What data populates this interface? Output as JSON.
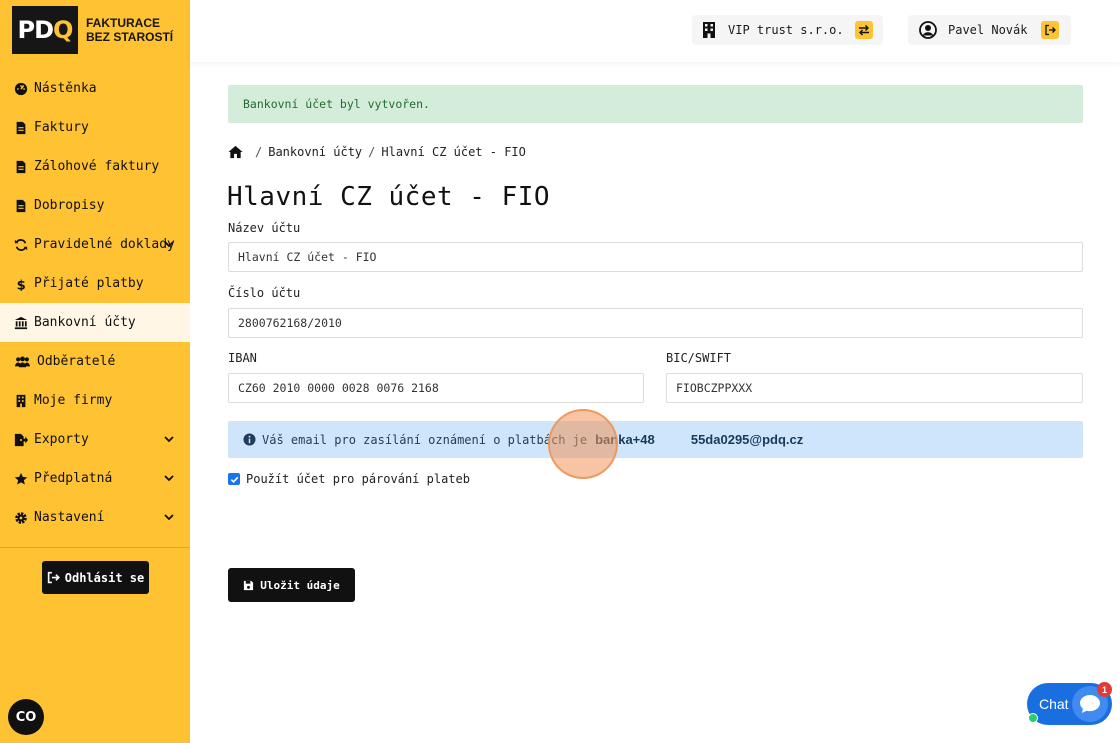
{
  "brand": {
    "logo_text": "PDQ",
    "tagline": "FAKTURACE BEZ STAROSTÍ"
  },
  "sidebar": {
    "items": [
      {
        "label": "Nástěnka",
        "icon": "dashboard-icon"
      },
      {
        "label": "Faktury",
        "icon": "file-icon"
      },
      {
        "label": "Zálohové faktury",
        "icon": "file-icon"
      },
      {
        "label": "Dobropisy",
        "icon": "file-icon"
      },
      {
        "label": "Pravidelné doklady",
        "icon": "sync-icon"
      },
      {
        "label": "Přijaté platby",
        "icon": "dollar-icon"
      },
      {
        "label": "Bankovní účty",
        "icon": "bank-icon",
        "active": true
      },
      {
        "label": "Odběratelé",
        "icon": "users-icon"
      },
      {
        "label": "Moje firmy",
        "icon": "building-icon"
      },
      {
        "label": "Exporty",
        "icon": "export-icon"
      },
      {
        "label": "Předplatná",
        "icon": "star-icon"
      },
      {
        "label": "Nastavení",
        "icon": "gear-icon"
      }
    ],
    "logout_label": "Odhlásit se",
    "co_badge": "CO"
  },
  "topbar": {
    "company": "VIP trust s.r.o.",
    "user": "Pavel Novák"
  },
  "alert_success": "Bankovní účet byl vytvořen.",
  "breadcrumb": {
    "level1": "Bankovní účty",
    "level2": "Hlavní CZ účet - FIO"
  },
  "page_title": "Hlavní CZ účet - FIO",
  "form": {
    "account_name_label": "Název účtu",
    "account_name_value": "Hlavní CZ účet - FIO",
    "account_number_label": "Číslo účtu",
    "account_number_value": "2800762168/2010",
    "iban_label": "IBAN",
    "iban_value": "CZ60 2010 0000 0028 0076 2168",
    "bic_label": "BIC/SWIFT",
    "bic_value": "FIOBCZPPXXX",
    "info_text": "Váš email pro zasílání oznámení o platbách je",
    "info_email": "banka+48          55da0295@pdq.cz",
    "checkbox_label": "Použít účet pro párování plateb",
    "save_label": "Uložit údaje"
  },
  "chat": {
    "label": "Chat",
    "badge": "1"
  },
  "colors": {
    "sidebar": "#ffc233",
    "accent": "#111111",
    "success_bg": "#d4edda",
    "info_bg": "#cfe5fb",
    "chat": "#1a6fe0"
  }
}
